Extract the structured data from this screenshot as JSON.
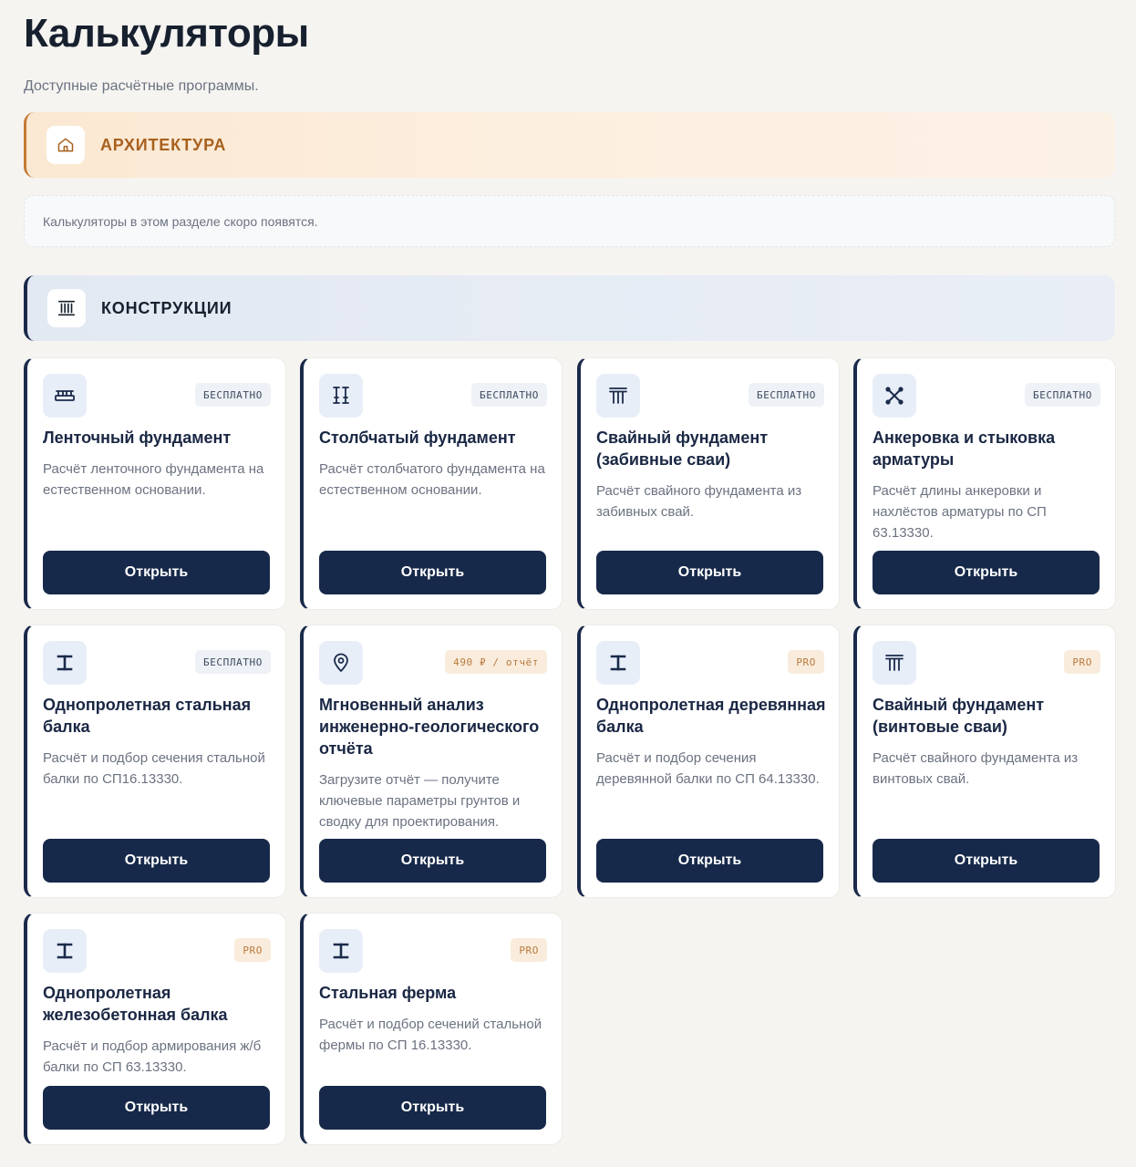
{
  "page": {
    "title": "Калькуляторы",
    "subtitle": "Доступные расчётные программы."
  },
  "sections": {
    "architecture": {
      "title": "АРХИТЕКТУРА",
      "icon": "home-icon",
      "notice": "Калькуляторы в этом разделе скоро появятся."
    },
    "constructions": {
      "title": "КОНСТРУКЦИИ",
      "icon": "columns-icon"
    }
  },
  "cards": [
    {
      "title": "Ленточный фундамент",
      "desc": "Расчёт ленточного фундамента на естественном основании.",
      "badge": "БЕСПЛАТНО",
      "badge_type": "free",
      "icon": "strip-foundation-icon",
      "button": "Открыть"
    },
    {
      "title": "Столбчатый фундамент",
      "desc": "Расчёт столбчатого фундамента на естественном основании.",
      "badge": "БЕСПЛАТНО",
      "badge_type": "free",
      "icon": "column-foundation-icon",
      "button": "Открыть"
    },
    {
      "title": "Свайный фундамент (забивные сваи)",
      "desc": "Расчёт свайного фундамента из забивных свай.",
      "badge": "БЕСПЛАТНО",
      "badge_type": "free",
      "icon": "pile-foundation-icon",
      "button": "Открыть"
    },
    {
      "title": "Анкеровка и стыковка арматуры",
      "desc": "Расчёт длины анкеровки и нахлёстов арматуры по СП 63.13330.",
      "badge": "БЕСПЛАТНО",
      "badge_type": "free",
      "icon": "cross-rebar-icon",
      "button": "Открыть"
    },
    {
      "title": "Однопролетная стальная балка",
      "desc": "Расчёт и подбор сечения стальной балки по СП16.13330.",
      "badge": "БЕСПЛАТНО",
      "badge_type": "free",
      "icon": "i-beam-icon",
      "button": "Открыть"
    },
    {
      "title": "Мгновенный анализ инженерно-геологического отчёта",
      "desc": "Загрузите отчёт — получите ключевые параметры грунтов и сводку для проектирования.",
      "badge": "490 ₽ / отчёт",
      "badge_type": "pro",
      "icon": "location-pin-icon",
      "button": "Открыть"
    },
    {
      "title": "Однопролетная деревянная балка",
      "desc": "Расчёт и подбор сечения деревянной балки по СП 64.13330.",
      "badge": "PRO",
      "badge_type": "pro",
      "icon": "i-beam-icon",
      "button": "Открыть"
    },
    {
      "title": "Свайный фундамент (винтовые сваи)",
      "desc": "Расчёт свайного фундамента из винтовых свай.",
      "badge": "PRO",
      "badge_type": "pro",
      "icon": "pile-foundation-icon",
      "button": "Открыть"
    },
    {
      "title": "Однопролетная железобетонная балка",
      "desc": "Расчёт и подбор армирования ж/б балки по СП 63.13330.",
      "badge": "PRO",
      "badge_type": "pro",
      "icon": "i-beam-icon",
      "button": "Открыть"
    },
    {
      "title": "Стальная ферма",
      "desc": "Расчёт и подбор сечений стальной фермы по СП 16.13330.",
      "badge": "PRO",
      "badge_type": "pro",
      "icon": "i-beam-icon",
      "button": "Открыть"
    }
  ],
  "colors": {
    "navy": "#17294a",
    "accent_orange": "#c27a32",
    "background": "#f5f4f1"
  }
}
